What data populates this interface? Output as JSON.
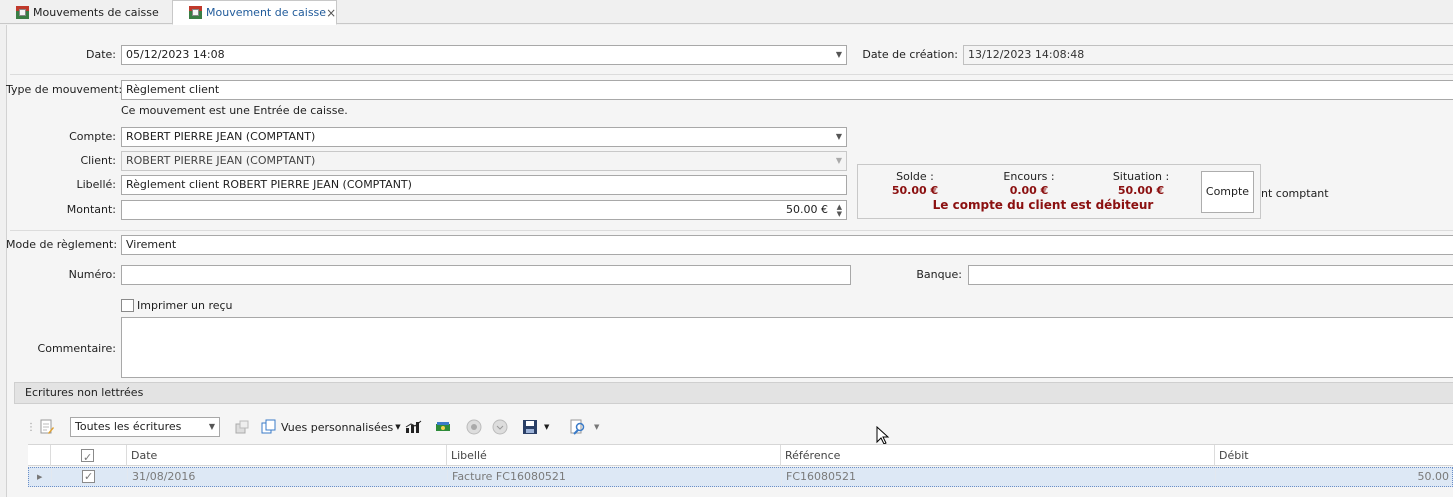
{
  "tabs": [
    {
      "label": "Mouvements de caisse"
    },
    {
      "label": "Mouvement de caisse",
      "close": "×"
    }
  ],
  "form": {
    "date_label": "Date:",
    "date_value": "05/12/2023 14:08",
    "creation_label": "Date de création:",
    "creation_value": "13/12/2023 14:08:48",
    "type_label": "Type de mouvement:",
    "type_value": "Règlement client",
    "type_info": "Ce mouvement est une Entrée de caisse.",
    "compte_label": "Compte:",
    "compte_value": "ROBERT PIERRE JEAN (COMPTANT)",
    "client_label": "Client:",
    "client_value": "ROBERT PIERRE JEAN (COMPTANT)",
    "libelle_label": "Libellé:",
    "libelle_value": "Règlement client ROBERT PIERRE JEAN (COMPTANT)",
    "montant_label": "Montant:",
    "montant_value": "50.00 €",
    "mode_label": "Mode de règlement:",
    "mode_value": "Virement",
    "numero_label": "Numéro:",
    "numero_value": "",
    "banque_label": "Banque:",
    "banque_value": "",
    "imprimer_label": "Imprimer un reçu",
    "commentaire_label": "Commentaire:",
    "commentaire_value": ""
  },
  "account": {
    "solde_label": "Solde :",
    "solde_value": "50.00 €",
    "encours_label": "Encours :",
    "encours_value": "0.00 €",
    "situation_label": "Situation :",
    "situation_value": "50.00 €",
    "message": "Le compte du client est débiteur",
    "button_label": "Compte",
    "trailing_text": "nt comptant"
  },
  "grid": {
    "section_title": "Ecritures non lettrées",
    "filter_value": "Toutes les écritures",
    "views_label": "Vues personnalisées",
    "columns": [
      "Date",
      "Libellé",
      "Référence",
      "Débit"
    ],
    "rows": [
      {
        "date": "31/08/2016",
        "libelle": "Facture FC16080521",
        "reference": "FC16080521",
        "debit": "50.00"
      }
    ]
  },
  "colors": {
    "accent_tab": "#1f5a9a",
    "debit_red": "#8b1010",
    "row_selected": "#dde8f5"
  }
}
